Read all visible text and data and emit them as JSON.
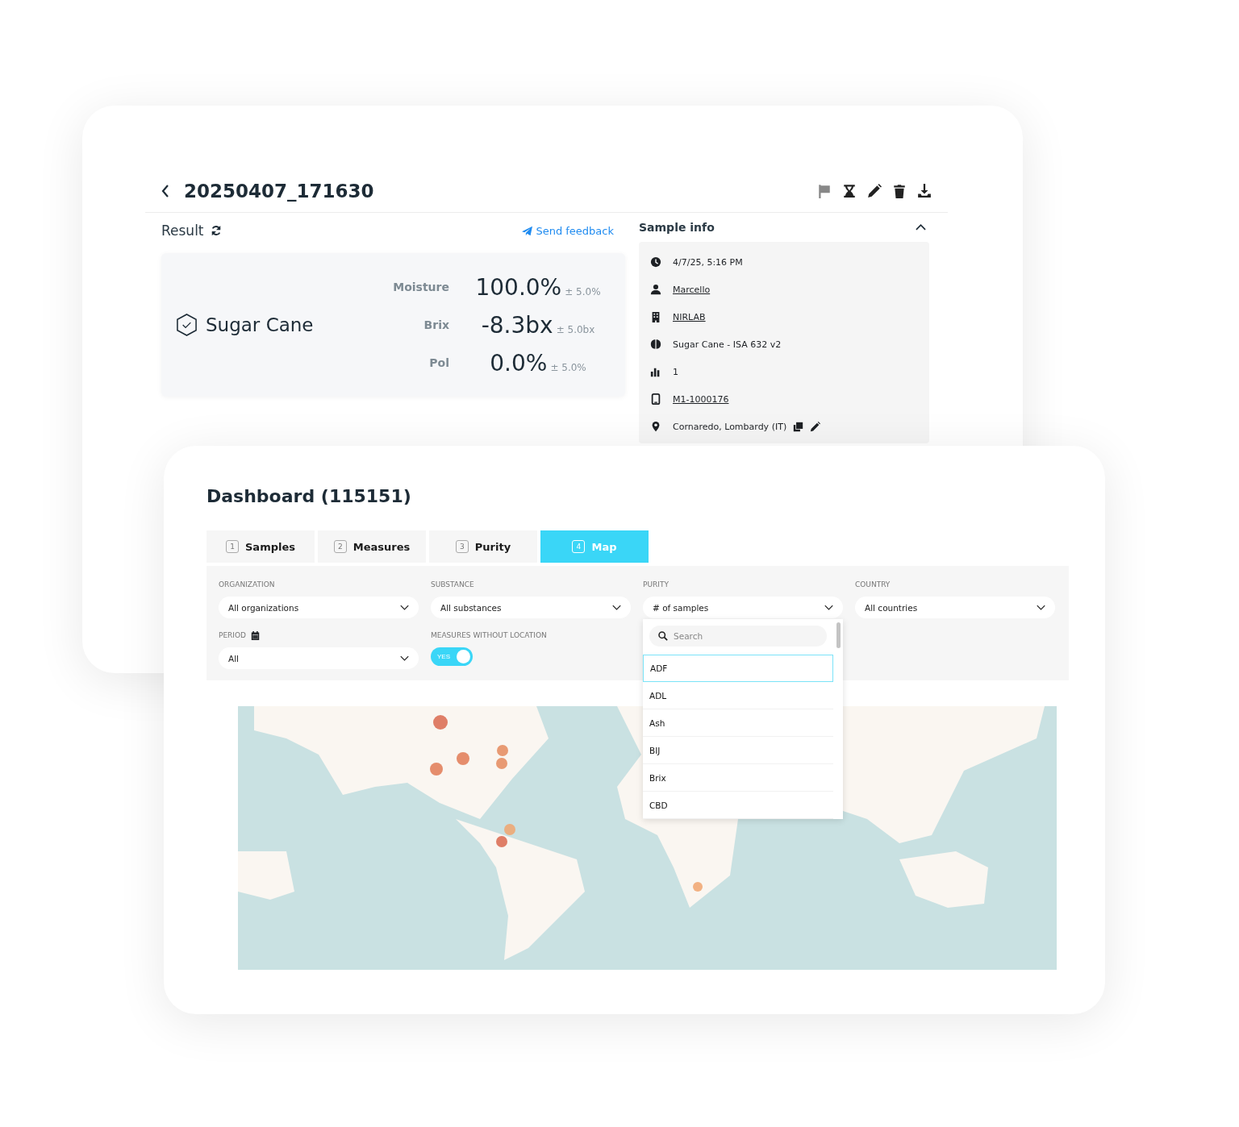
{
  "sample": {
    "title": "20250407_171630",
    "actions": [
      {
        "kind": "flag",
        "disabled": true
      },
      {
        "kind": "hourglass",
        "disabled": false
      },
      {
        "kind": "edit",
        "disabled": false
      },
      {
        "kind": "delete",
        "disabled": false
      },
      {
        "kind": "download",
        "disabled": false
      }
    ],
    "result": {
      "label": "Result",
      "feedback": "Send feedback",
      "substance": "Sugar Cane",
      "measures": [
        {
          "name": "Moisture",
          "value": "100.0%",
          "tolerance": "± 5.0%"
        },
        {
          "name": "Brix",
          "value": "-8.3bx",
          "tolerance": "± 5.0bx"
        },
        {
          "name": "Pol",
          "value": "0.0%",
          "tolerance": "± 5.0%"
        }
      ]
    },
    "sample_info": {
      "title": "Sample info",
      "expanded": true,
      "rows": [
        {
          "kind": "time",
          "text": "4/7/25, 5:16 PM",
          "link": false
        },
        {
          "kind": "user",
          "text": "Marcello",
          "link": true
        },
        {
          "kind": "organization",
          "text": "NIRLAB",
          "link": true
        },
        {
          "kind": "model",
          "text": "Sugar Cane - ISA 632 v2",
          "link": false
        },
        {
          "kind": "count",
          "text": "1",
          "link": false
        },
        {
          "kind": "device",
          "text": "M1-1000176",
          "link": true
        },
        {
          "kind": "location",
          "text": "Cornaredo, Lombardy (IT)",
          "link": false
        }
      ]
    }
  },
  "dashboard": {
    "title": "Dashboard (115151)",
    "tabs": [
      {
        "number": "1",
        "label": "Samples",
        "selected": false
      },
      {
        "number": "2",
        "label": "Measures",
        "selected": false
      },
      {
        "number": "3",
        "label": "Purity",
        "selected": false
      },
      {
        "number": "4",
        "label": "Map",
        "selected": true
      }
    ],
    "filters": [
      {
        "kind": "select",
        "label": "ORGANIZATION",
        "value": "All organizations"
      },
      {
        "kind": "select",
        "label": "SUBSTANCE",
        "value": "All substances"
      },
      {
        "kind": "select",
        "label": "PURITY",
        "value": "# of samples",
        "expanded": true,
        "search_placeholder": "Search",
        "options": [
          {
            "label": "ADF",
            "selected": true
          },
          {
            "label": "ADL",
            "selected": false
          },
          {
            "label": "Ash",
            "selected": false
          },
          {
            "label": "BIJ",
            "selected": false
          },
          {
            "label": "Brix",
            "selected": false
          },
          {
            "label": "CBD",
            "selected": false
          }
        ]
      },
      {
        "kind": "select",
        "label": "COUNTRY",
        "value": "All countries"
      },
      {
        "kind": "select",
        "label": "PERIOD",
        "value": "All",
        "calendar": true
      },
      {
        "kind": "toggle",
        "label": "MEASURES WITHOUT LOCATION",
        "on": true,
        "text": "YES"
      }
    ]
  }
}
